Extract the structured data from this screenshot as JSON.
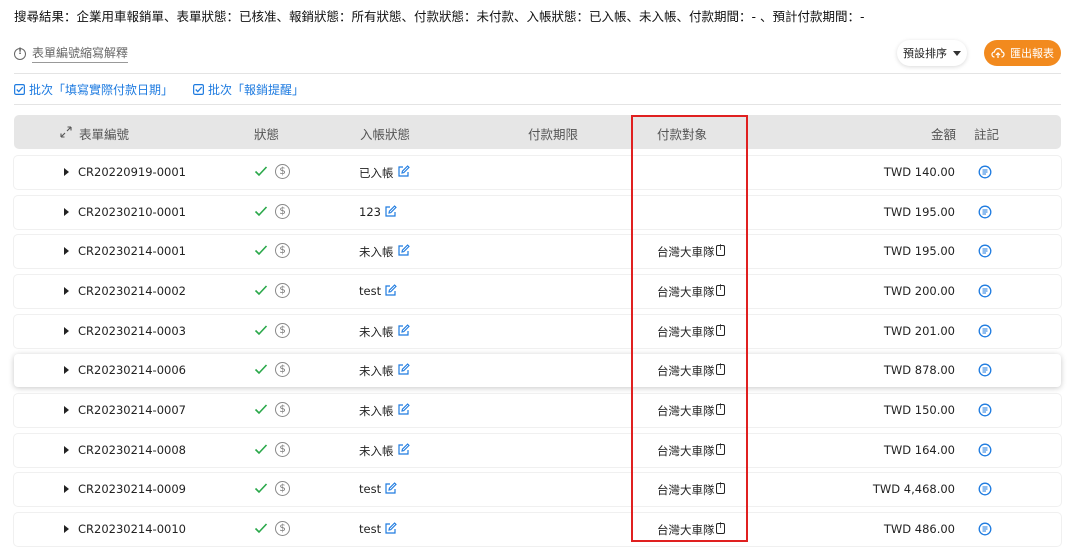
{
  "header": {
    "search_summary": "搜尋結果：企業用車報銷單、表單狀態：已核准、報銷狀態：所有狀態、付款狀態：未付款、入帳狀態：已入帳、未入帳、付款期間：- 、預計付款期間：-",
    "abbr_link_label": "表單編號縮寫解釋",
    "sort_label": "預設排序",
    "export_label": "匯出報表"
  },
  "batch_actions": [
    {
      "label": "批次「填寫實際付款日期」"
    },
    {
      "label": "批次「報銷提醒」"
    }
  ],
  "table": {
    "columns": {
      "form_no": "表單編號",
      "status": "狀態",
      "posting_status": "入帳狀態",
      "payment_term": "付款期限",
      "payee": "付款對象",
      "amount": "金額",
      "note": "註記"
    },
    "rows": [
      {
        "form_no": "CR20220919-0001",
        "posting": "已入帳",
        "payee": "",
        "amount": "TWD 140.00"
      },
      {
        "form_no": "CR20230210-0001",
        "posting": "123",
        "payee": "",
        "amount": "TWD 195.00"
      },
      {
        "form_no": "CR20230214-0001",
        "posting": "未入帳",
        "payee": "台灣大車隊",
        "amount": "TWD 195.00"
      },
      {
        "form_no": "CR20230214-0002",
        "posting": "test",
        "payee": "台灣大車隊",
        "amount": "TWD 200.00"
      },
      {
        "form_no": "CR20230214-0003",
        "posting": "未入帳",
        "payee": "台灣大車隊",
        "amount": "TWD 201.00"
      },
      {
        "form_no": "CR20230214-0006",
        "posting": "未入帳",
        "payee": "台灣大車隊",
        "amount": "TWD 878.00"
      },
      {
        "form_no": "CR20230214-0007",
        "posting": "未入帳",
        "payee": "台灣大車隊",
        "amount": "TWD 150.00"
      },
      {
        "form_no": "CR20230214-0008",
        "posting": "未入帳",
        "payee": "台灣大車隊",
        "amount": "TWD 164.00"
      },
      {
        "form_no": "CR20230214-0009",
        "posting": "test",
        "payee": "台灣大車隊",
        "amount": "TWD 4,468.00"
      },
      {
        "form_no": "CR20230214-0010",
        "posting": "test",
        "payee": "台灣大車隊",
        "amount": "TWD 486.00"
      }
    ]
  },
  "icons": {
    "status_check": "check-icon",
    "payment": "dollar-circle-icon",
    "edit": "edit-icon",
    "payee_info": "info-tag-icon",
    "note": "note-icon",
    "expand": "expand-arrows-icon",
    "row_toggle": "caret-right-icon"
  },
  "colors": {
    "accent_blue": "#1e7be0",
    "export_orange": "#f28a1e",
    "check_green": "#2aa84a",
    "highlight_red": "#e02020"
  }
}
